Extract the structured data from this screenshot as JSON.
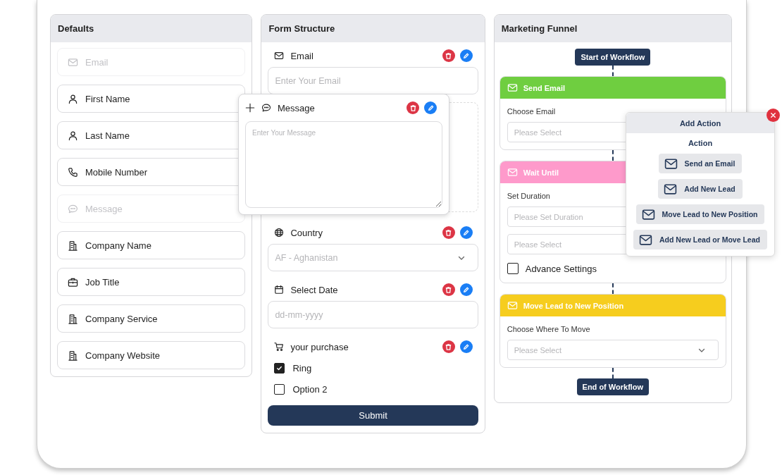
{
  "defaults": {
    "title": "Defaults",
    "items": [
      {
        "label": "Email",
        "kind": "email",
        "disabled": true
      },
      {
        "label": "First Name",
        "kind": "name",
        "disabled": false
      },
      {
        "label": "Last Name",
        "kind": "name",
        "disabled": false
      },
      {
        "label": "Mobile Number",
        "kind": "phone",
        "disabled": false
      },
      {
        "label": "Message",
        "kind": "message",
        "disabled": true
      },
      {
        "label": "Company Name",
        "kind": "company",
        "disabled": false
      },
      {
        "label": "Job Title",
        "kind": "job",
        "disabled": false
      },
      {
        "label": "Company Service",
        "kind": "company",
        "disabled": false
      },
      {
        "label": "Company Website",
        "kind": "company",
        "disabled": false
      }
    ]
  },
  "form_structure": {
    "title": "Form Structure",
    "fields": [
      {
        "kind": "text",
        "label": "Email",
        "placeholder": "Enter Your Email"
      },
      {
        "kind": "drop-zone"
      },
      {
        "kind": "select",
        "label": "Country",
        "placeholder": "AF - Aghanistan"
      },
      {
        "kind": "text",
        "label": "Select Date",
        "placeholder": "dd-mm-yyyy"
      },
      {
        "kind": "checkboxes",
        "label": "your purchase",
        "options": [
          {
            "label": "Ring",
            "checked": true
          },
          {
            "label": "Option 2",
            "checked": false
          }
        ]
      }
    ],
    "submit": "Submit"
  },
  "dragged_field": {
    "label": "Message",
    "placeholder": "Enter Your Message"
  },
  "marketing_funnel": {
    "title": "Marketing Funnel",
    "start": "Start of Workflow",
    "end": "End of Workflow",
    "steps": [
      {
        "title": "Send Email",
        "color": "#6fce40",
        "fields": [
          {
            "kind": "label",
            "text": "Choose Email"
          },
          {
            "kind": "select",
            "placeholder": "Please Select"
          }
        ]
      },
      {
        "title": "Wait Until",
        "color": "#fe9acb",
        "fields": [
          {
            "kind": "label",
            "text": "Set Duration"
          },
          {
            "kind": "input",
            "placeholder": "Please Set Duration"
          },
          {
            "kind": "select",
            "placeholder": "Please Select"
          },
          {
            "kind": "checkbox",
            "label": "Advance Settings",
            "checked": false
          }
        ]
      },
      {
        "title": "Move Lead to New Position",
        "color": "#f6cd1e",
        "fields": [
          {
            "kind": "label",
            "text": "Choose Where To Move"
          },
          {
            "kind": "select",
            "placeholder": "Please Select"
          }
        ]
      }
    ]
  },
  "add_action": {
    "title": "Add Action",
    "subtitle": "Action",
    "actions": [
      "Send an Email",
      "Add New Lead",
      "Move Lead to New Position",
      "Add New Lead or Move Lead"
    ]
  }
}
